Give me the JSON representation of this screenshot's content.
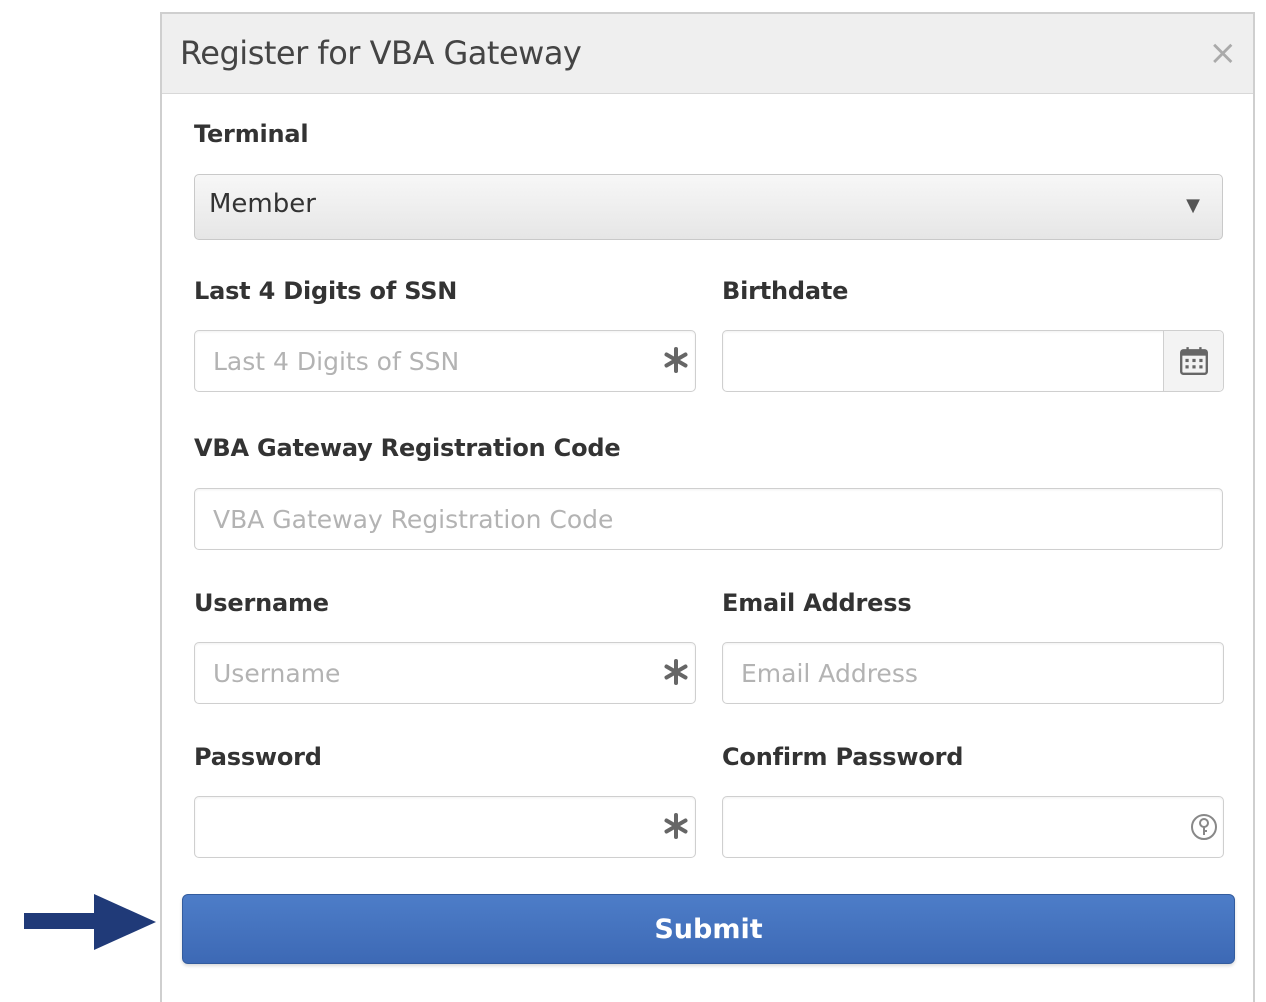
{
  "modal": {
    "title": "Register for VBA Gateway",
    "close_symbol": "×"
  },
  "terminal": {
    "label": "Terminal",
    "selected": "Member"
  },
  "ssn": {
    "label": "Last 4 Digits of SSN",
    "placeholder": "Last 4 Digits of SSN",
    "value": ""
  },
  "birthdate": {
    "label": "Birthdate",
    "value": ""
  },
  "registration_code": {
    "label": "VBA Gateway Registration Code",
    "placeholder": "VBA Gateway Registration Code",
    "value": ""
  },
  "username": {
    "label": "Username",
    "placeholder": "Username",
    "value": ""
  },
  "email": {
    "label": "Email Address",
    "placeholder": "Email Address",
    "value": ""
  },
  "password": {
    "label": "Password",
    "value": ""
  },
  "confirm_password": {
    "label": "Confirm Password",
    "value": ""
  },
  "submit": {
    "label": "Submit"
  },
  "colors": {
    "submit_blue": "#4470bd",
    "arrow_navy": "#203a78"
  },
  "icons": {
    "required": "asterisk-icon",
    "calendar": "calendar-icon",
    "password_reveal": "key-icon",
    "pointer": "arrow-right-icon"
  }
}
